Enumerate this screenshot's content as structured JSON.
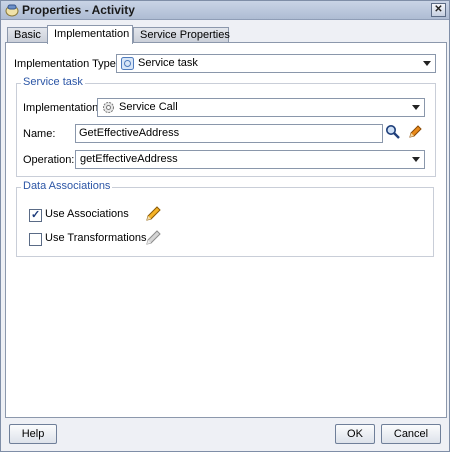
{
  "window": {
    "title": "Properties - Activity",
    "close_label": "✕"
  },
  "tabs": [
    {
      "label": "Basic"
    },
    {
      "label": "Implementation"
    },
    {
      "label": "Service Properties"
    }
  ],
  "implementation_type": {
    "label": "Implementation Type:",
    "value": "Service task",
    "icon": "service-task-icon"
  },
  "service_task": {
    "title": "Service task",
    "implementation": {
      "label": "Implementation:",
      "value": "Service Call",
      "icon": "gear-icon"
    },
    "name": {
      "label": "Name:",
      "value": "GetEffectiveAddress"
    },
    "operation": {
      "label": "Operation:",
      "value": "getEffectiveAddress"
    }
  },
  "data_associations": {
    "title": "Data Associations",
    "use_associations": {
      "label": "Use Associations",
      "checked": true
    },
    "use_transformations": {
      "label": "Use Transformations",
      "checked": false
    }
  },
  "footer": {
    "help": "Help",
    "ok": "OK",
    "cancel": "Cancel"
  },
  "colors": {
    "accent_title": "#2c56a6",
    "titlebar": "#aebcd3"
  }
}
